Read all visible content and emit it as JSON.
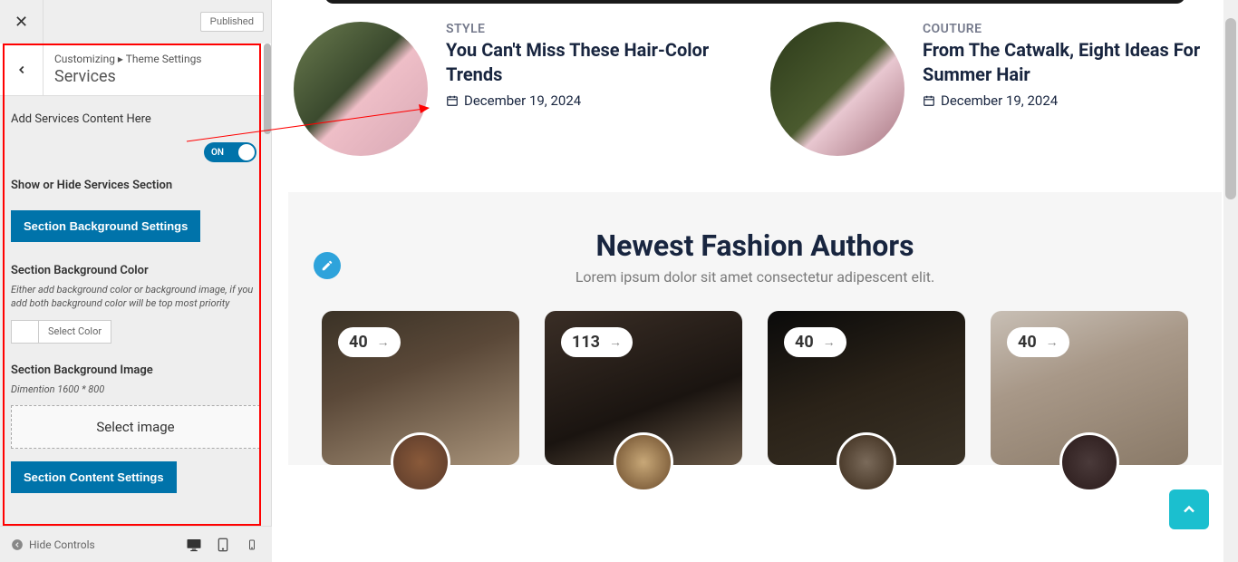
{
  "topbar": {
    "published_label": "Published"
  },
  "panel": {
    "breadcrumb": "Customizing ▸ Theme Settings",
    "title": "Services",
    "add_label": "Add Services Content Here",
    "toggle_label": "ON",
    "show_hide_label": "Show or Hide Services Section",
    "bg_settings_btn": "Section Background Settings",
    "bg_color_label": "Section Background Color",
    "bg_color_hint": "Either add background color or background image, if you add both background color will be top most priority",
    "select_color_label": "Select Color",
    "bg_image_label": "Section Background Image",
    "bg_image_hint": "Dimention 1600 * 800",
    "select_image_label": "Select image",
    "content_settings_btn": "Section Content Settings"
  },
  "bottom": {
    "hide_controls": "Hide Controls"
  },
  "preview": {
    "articles": [
      {
        "category": "STYLE",
        "title": "You Can't Miss These Hair-Color Trends",
        "date": "December 19, 2024"
      },
      {
        "category": "COUTURE",
        "title": "From The Catwalk, Eight Ideas For Summer Hair",
        "date": "December 19, 2024"
      }
    ],
    "authors_section": {
      "title": "Newest Fashion Authors",
      "subtitle": "Lorem ipsum dolor sit amet consectetur adipescent elit.",
      "cards": [
        {
          "count": "40"
        },
        {
          "count": "113"
        },
        {
          "count": "40"
        },
        {
          "count": "40"
        }
      ]
    }
  }
}
